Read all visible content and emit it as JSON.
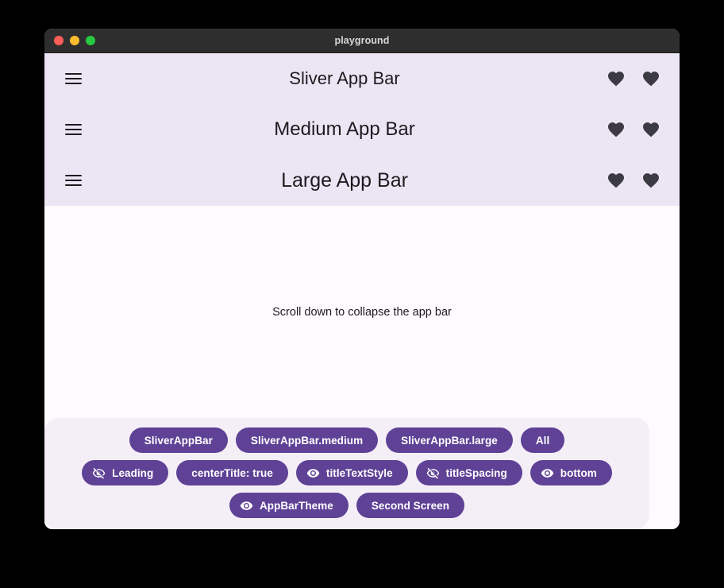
{
  "window": {
    "title": "playground",
    "traffic_lights": [
      {
        "name": "close",
        "color": "#ff5f57"
      },
      {
        "name": "minimize",
        "color": "#febc2e"
      },
      {
        "name": "maximize",
        "color": "#28c840"
      }
    ]
  },
  "colors": {
    "appbar_background": "#ece6f4",
    "content_background": "#fefafd",
    "panel_background": "#f4eff7",
    "chip_purple": "#5f4296",
    "chip_text": "#ffffff",
    "icon_dark": "#1c1b1e",
    "titlebar_background": "#2e2e2e",
    "titlebar_text": "#d8d8d8"
  },
  "appbars": [
    {
      "id": "sliver-app-bar",
      "title": "Sliver App Bar",
      "leading_icon": "menu-icon",
      "actions": [
        "favorite-icon",
        "favorite-icon"
      ]
    },
    {
      "id": "medium-app-bar",
      "title": "Medium App Bar",
      "leading_icon": "menu-icon",
      "actions": [
        "favorite-icon",
        "favorite-icon"
      ]
    },
    {
      "id": "large-app-bar",
      "title": "Large App Bar",
      "leading_icon": "menu-icon",
      "actions": [
        "favorite-icon",
        "favorite-icon"
      ]
    }
  ],
  "content": {
    "hint_text": "Scroll down to collapse the app bar"
  },
  "panel": {
    "rows": [
      {
        "chips": [
          {
            "label": "SliverAppBar",
            "icon": null
          },
          {
            "label": "SliverAppBar.medium",
            "icon": null
          },
          {
            "label": "SliverAppBar.large",
            "icon": null
          },
          {
            "label": "All",
            "icon": null
          }
        ]
      },
      {
        "chips": [
          {
            "label": "Leading",
            "icon": "visibility-off-icon"
          },
          {
            "label": "centerTitle: true",
            "icon": null
          },
          {
            "label": "titleTextStyle",
            "icon": "visibility-on-icon"
          },
          {
            "label": "titleSpacing",
            "icon": "visibility-off-icon"
          },
          {
            "label": "bottom",
            "icon": "visibility-on-icon"
          }
        ]
      },
      {
        "chips": [
          {
            "label": "AppBarTheme",
            "icon": "visibility-on-icon"
          },
          {
            "label": "Second Screen",
            "icon": null
          }
        ]
      }
    ]
  }
}
